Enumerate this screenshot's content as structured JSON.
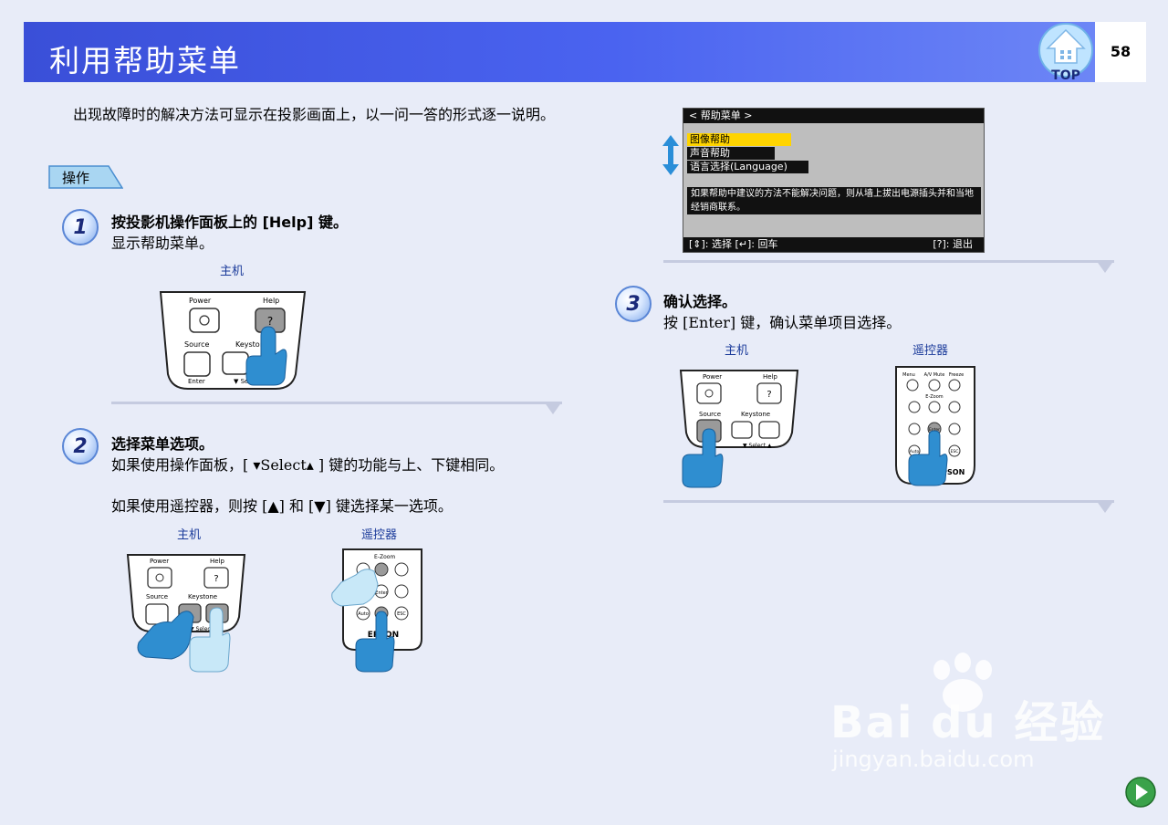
{
  "header": {
    "title": "利用帮助菜单",
    "top_label": "TOP",
    "page_number": "58"
  },
  "intro": "出现故障时的解决方法可显示在投影画面上，以一问一答的形式逐一说明。",
  "operation_tag": "操作",
  "steps": [
    {
      "num": "1",
      "title": "按投影机操作面板上的 [Help] 键。",
      "desc": "显示帮助菜单。",
      "label_main": "主机"
    },
    {
      "num": "2",
      "title": "选择菜单选项。",
      "desc1": "如果使用操作面板，[ ▾Select▴ ] 键的功能与上、下键相同。",
      "desc2": "如果使用遥控器，则按 [▲] 和 [▼] 键选择某一选项。",
      "label_main": "主机",
      "label_remote": "遥控器"
    },
    {
      "num": "3",
      "title": "确认选择。",
      "desc": "按 [Enter] 键，确认菜单项目选择。",
      "label_main": "主机",
      "label_remote": "遥控器"
    }
  ],
  "panel": {
    "power": "Power",
    "help": "Help",
    "source": "Source",
    "keystone": "Keystone",
    "enter": "Enter",
    "select": "▼ Select ▲",
    "help_key": "?"
  },
  "remote": {
    "menu": "Menu",
    "av_mute": "A/V Mute",
    "freeze": "Freeze",
    "ezoom": "E-Zoom",
    "enter": "Enter",
    "auto": "Auto",
    "esc": "ESC",
    "brand": "EPSON"
  },
  "help_screen": {
    "title": "< 帮助菜单 >",
    "items": [
      "图像帮助",
      "声音帮助",
      "语言选择(Language)"
    ],
    "note": "如果帮助中建议的方法不能解决问题，则从墙上拔出电源插头并和当地经销商联系。",
    "footer_left": "[⇕]: 选择  [↵]: 回车",
    "footer_right": "[?]: 退出"
  },
  "watermark": {
    "brand": "Bai du 经验",
    "url": "jingyan.baidu.com"
  },
  "colors": {
    "header": "#4a63f0",
    "accent": "#1a3a9a",
    "highlight": "#ffd400",
    "finger": "#2f8ed0"
  }
}
